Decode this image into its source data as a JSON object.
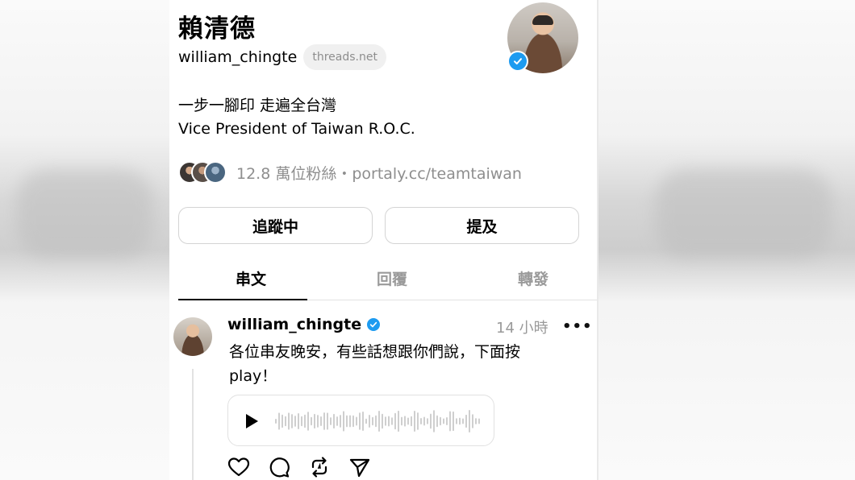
{
  "profile": {
    "display_name": "賴清德",
    "username": "william_chingte",
    "domain_badge": "threads.net",
    "bio_line1": "一步一腳印 走遍全台灣",
    "bio_line2": "Vice President of Taiwan R.O.C.",
    "followers_text": "12.8 萬位粉絲・portaly.cc/teamtaiwan",
    "verified": true
  },
  "buttons": {
    "following_label": "追蹤中",
    "mention_label": "提及"
  },
  "tabs": [
    {
      "label": "串文",
      "active": true
    },
    {
      "label": "回覆",
      "active": false
    },
    {
      "label": "轉發",
      "active": false
    }
  ],
  "post": {
    "username": "william_chingte",
    "time": "14 小時",
    "more_label": "•••",
    "text": "各位串友晚安，有些話想跟你們說，下面按play！",
    "audio": {
      "playing": false
    }
  },
  "icons": [
    "verified-badge-icon",
    "play-icon",
    "waveform-icon",
    "heart-icon",
    "comment-icon",
    "repost-icon",
    "share-icon",
    "more-icon"
  ],
  "colors": {
    "verified": "#1d9bf0",
    "muted_text": "#8e8e8e"
  }
}
